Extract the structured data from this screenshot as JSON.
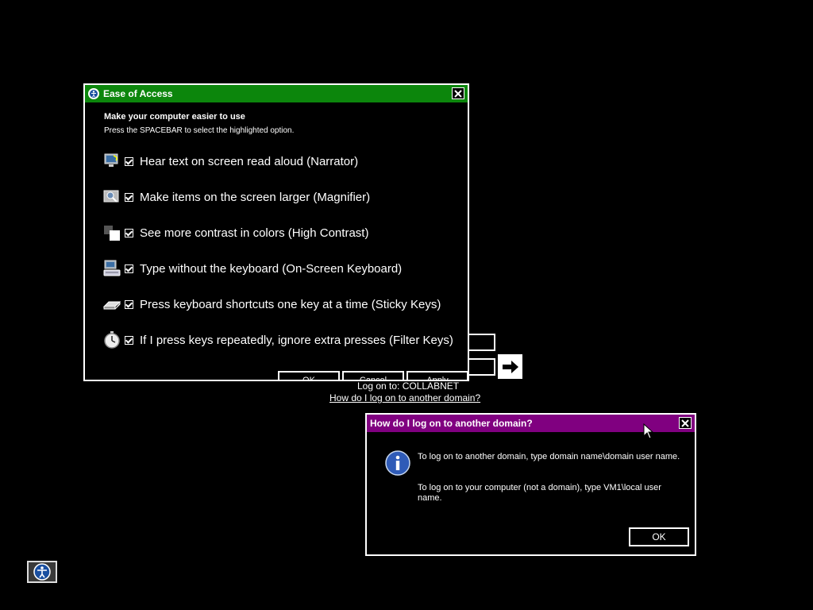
{
  "login": {
    "logon_to": "Log on to: COLLABNET",
    "other_domain_link": "How do I log on to another domain?"
  },
  "ease_of_access": {
    "title": "Ease of Access",
    "heading": "Make your computer easier to use",
    "subtext": "Press the SPACEBAR to select the highlighted option.",
    "options": [
      {
        "label": "Hear text on screen read aloud (Narrator)",
        "checked": true,
        "icon": "narrator-icon"
      },
      {
        "label": "Make items on the screen larger (Magnifier)",
        "checked": true,
        "icon": "magnifier-icon"
      },
      {
        "label": "See more contrast in colors (High Contrast)",
        "checked": true,
        "icon": "high-contrast-icon"
      },
      {
        "label": "Type without the keyboard (On-Screen Keyboard)",
        "checked": true,
        "icon": "keyboard-icon"
      },
      {
        "label": "Press keyboard shortcuts one key at a time (Sticky Keys)",
        "checked": true,
        "icon": "sticky-keys-icon"
      },
      {
        "label": "If I press keys repeatedly, ignore extra presses (Filter Keys)",
        "checked": true,
        "icon": "stopwatch-icon"
      }
    ],
    "buttons": {
      "ok": "OK",
      "cancel": "Cancel",
      "apply": "Apply"
    }
  },
  "domain_dialog": {
    "title": "How do I log on to another domain?",
    "text1": "To log on to another domain, type domain name\\domain user name.",
    "text2": "To log on to your computer (not a domain), type VM1\\local user name.",
    "ok": "OK"
  },
  "colors": {
    "eoa_titlebar": "#0c860c",
    "dialog_titlebar": "#800080",
    "background": "#000000"
  }
}
